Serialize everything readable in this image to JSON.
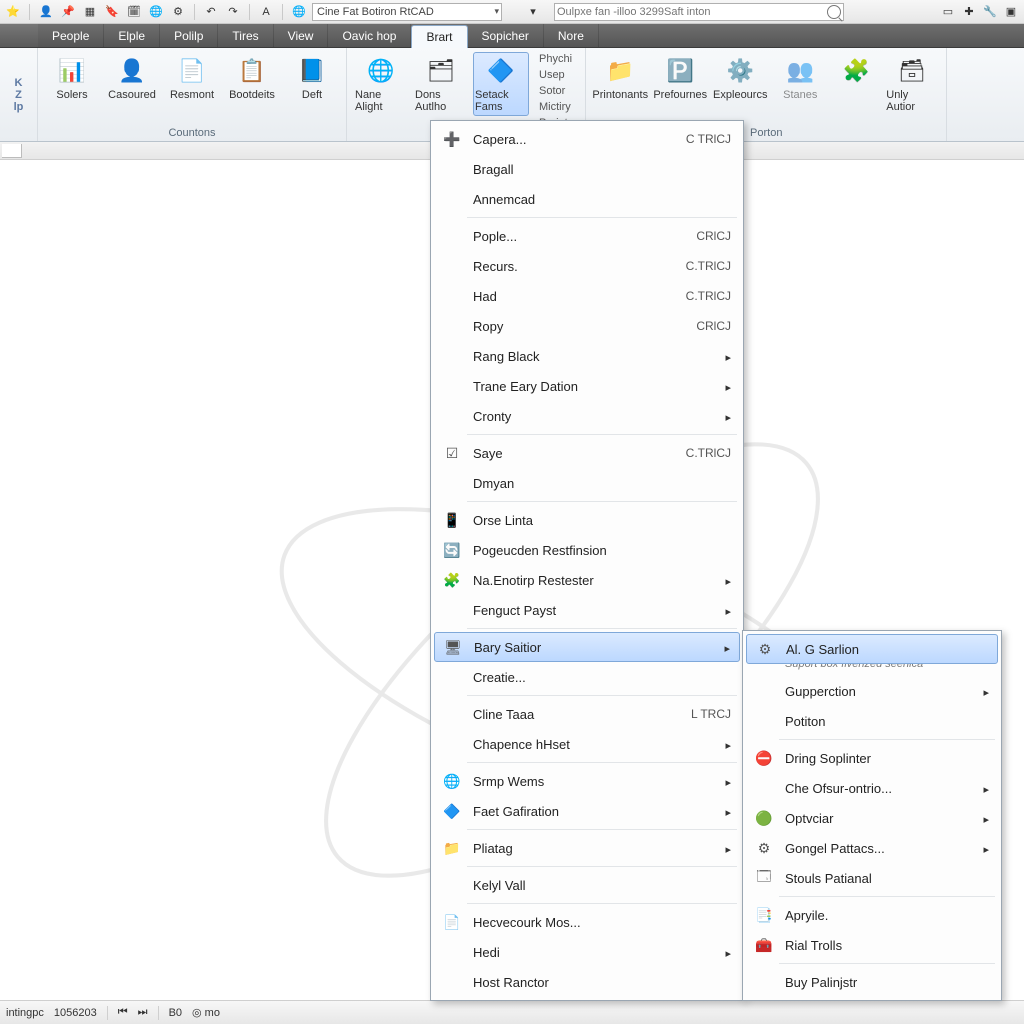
{
  "qat": {
    "title_combo": "Cine Fat Botiron RtCAD",
    "search_placeholder": "Oulpxe fan -illoo 3299Saft inton"
  },
  "menubar": {
    "items": [
      "People",
      "Elple",
      "Polilp",
      "Tires",
      "View",
      "Oavic hop",
      "Brart",
      "Sopicher",
      "Nore"
    ],
    "active_index": 6
  },
  "ribbon": {
    "left_letters": [
      "K",
      "Z",
      "lp"
    ],
    "groups": [
      {
        "caption": "Countons",
        "buttons": [
          {
            "label": "Solers",
            "icon": "📊",
            "name": "solers"
          },
          {
            "label": "Casoured",
            "icon": "👤",
            "name": "casoured"
          },
          {
            "label": "Resmont",
            "icon": "📄",
            "name": "resmont"
          },
          {
            "label": "Bootdeits",
            "icon": "📋",
            "name": "bootdeits"
          },
          {
            "label": "Deft",
            "icon": "📘",
            "name": "deft"
          }
        ]
      },
      {
        "caption": "",
        "buttons": [
          {
            "label": "Nane Alight",
            "icon": "🌐",
            "name": "nane-alight"
          },
          {
            "label": "Dons Autlho",
            "icon": "🗂",
            "name": "dons-autho"
          },
          {
            "label": "Setack Fams",
            "icon": "🔷",
            "name": "setack",
            "active": true
          }
        ],
        "extra_rows": [
          {
            "label": "Phychi",
            "name": "phychi"
          },
          {
            "label": "Usep",
            "name": "usep"
          },
          {
            "label": "Sotor",
            "name": "sotor"
          }
        ],
        "extra_rows2": [
          {
            "label": "Mictiry",
            "name": "mictiry"
          },
          {
            "label": "Pruiats",
            "name": "pruiats"
          }
        ]
      },
      {
        "caption": "Porton",
        "buttons": [
          {
            "label": "Printonants",
            "icon": "📁",
            "name": "printonants"
          },
          {
            "label": "Prefournes",
            "icon": "🅿️",
            "name": "prefournes"
          },
          {
            "label": "Expleourcs",
            "icon": "⚙️",
            "name": "expleourcs"
          },
          {
            "label": "Stanes",
            "icon": "👥",
            "name": "stanes",
            "disabled": true
          },
          {
            "label": "",
            "icon": "🧩",
            "name": "puzzle",
            "sm": true
          },
          {
            "label": "Unly Autior",
            "icon": "🗃",
            "name": "unly-autior"
          }
        ]
      }
    ]
  },
  "menu": {
    "items": [
      {
        "label": "Capera...",
        "accel": "C TRlCJ",
        "icon": "➕"
      },
      {
        "label": "Bragall"
      },
      {
        "label": "Annemcad"
      },
      {
        "sep": true
      },
      {
        "label": "Pople...",
        "accel": "CRlCJ"
      },
      {
        "label": "Recurs.",
        "accel": "C.TRlCJ"
      },
      {
        "label": "Had",
        "accel": "C.TRlCJ"
      },
      {
        "label": "Ropy",
        "accel": "CRlCJ"
      },
      {
        "label": "Rang Black",
        "submenu": true
      },
      {
        "label": "Trane Eary Dation",
        "submenu": true
      },
      {
        "label": "Cronty",
        "submenu": true
      },
      {
        "sep": true
      },
      {
        "label": "Saye",
        "accel": "C.TRlCJ",
        "icon": "☑"
      },
      {
        "label": "Dmyan"
      },
      {
        "sep": true
      },
      {
        "label": "Orse Linta",
        "icon": "📱"
      },
      {
        "label": "Pogeucden Restfinsion",
        "icon": "🔄"
      },
      {
        "label": "Na.Enotirp Restester",
        "icon": "🧩",
        "submenu": true
      },
      {
        "label": "Fenguct Payst",
        "submenu": true
      },
      {
        "sep": true
      },
      {
        "label": "Bary Saitior",
        "icon": "🖥",
        "submenu": true,
        "hl": true
      },
      {
        "label": "Creatie..."
      },
      {
        "sep": true
      },
      {
        "label": "Cline Taaa",
        "accel": "L TRCJ"
      },
      {
        "label": "Chapence hHset",
        "submenu": true
      },
      {
        "sep": true
      },
      {
        "label": "Srmp Wems",
        "icon": "🌐",
        "submenu": true
      },
      {
        "label": "Faet Gafiration",
        "icon": "🔷",
        "submenu": true
      },
      {
        "sep": true
      },
      {
        "label": "Pliatag",
        "icon": "📁",
        "submenu": true
      },
      {
        "sep": true
      },
      {
        "label": "Kelyl Vall"
      },
      {
        "sep": true
      },
      {
        "label": "Hecvecourk Mos...",
        "icon": "📄"
      },
      {
        "label": "Hedi",
        "submenu": true
      },
      {
        "label": "Host Ranctor"
      }
    ]
  },
  "submenu": {
    "items": [
      {
        "label": "Al. G Sarlion",
        "icon": "⚙",
        "hl": true,
        "desc": "Suport box fivenzed seenica"
      },
      {
        "label": "Gupperction",
        "submenu": true
      },
      {
        "label": "Potiton"
      },
      {
        "sep": true
      },
      {
        "label": "Dring Soplinter",
        "icon": "⛔"
      },
      {
        "label": "Che Ofsur-ontrio...",
        "submenu": true
      },
      {
        "label": "Optvciar",
        "icon": "🟢",
        "submenu": true
      },
      {
        "label": "Gongel Pattacs...",
        "icon": "⚙",
        "submenu": true
      },
      {
        "label": "Stouls Patianal",
        "icon": "🗔"
      },
      {
        "sep": true
      },
      {
        "label": "Apryile.",
        "icon": "📑"
      },
      {
        "label": "Rial Trolls",
        "icon": "🧰"
      },
      {
        "sep": true
      },
      {
        "label": "Buy Palinjstr"
      }
    ]
  },
  "status": {
    "left": "intingpc",
    "value": "1056203",
    "mid_icons": [
      "⏮",
      "⏭"
    ],
    "b": "B0",
    "c": "◎ mo"
  }
}
